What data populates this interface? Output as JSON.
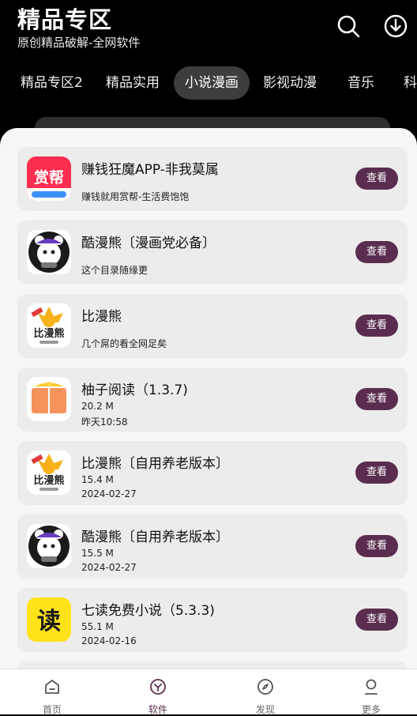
{
  "header": {
    "title": "精品专区",
    "subtitle": "原创精品破解-全网软件"
  },
  "tabs": [
    "精品专区2",
    "精品实用",
    "小说漫画",
    "影视动漫",
    "音乐",
    "科"
  ],
  "active_tab": "小说漫画",
  "apps": [
    {
      "name": "赚钱狂魔APP-非我莫属",
      "desc": "赚钱就用赏帮-生活费饱饱",
      "button": "查看",
      "icon": "shangbang-icon",
      "icon_text": "赏帮"
    },
    {
      "name": "酷漫熊〔漫画党必备〕",
      "desc": "这个目录随缘更",
      "button": "查看",
      "icon": "kumanxiong-icon"
    },
    {
      "name": "比漫熊",
      "desc": "几个屌的看全网足矣",
      "button": "查看",
      "icon": "bimanxiong-icon",
      "icon_text": "比漫熊"
    },
    {
      "name": "柚子阅读（1.3.7)",
      "size": "20.2 M",
      "date": "昨天10:58",
      "button": "查看",
      "icon": "book-icon"
    },
    {
      "name": "比漫熊〔自用养老版本〕",
      "size": "15.4 M",
      "date": "2024-02-27",
      "button": "查看",
      "icon": "bimanxiong-icon",
      "icon_text": "比漫熊"
    },
    {
      "name": "酷漫熊〔自用养老版本〕",
      "size": "15.5 M",
      "date": "2024-02-27",
      "button": "查看",
      "icon": "kumanxiong-icon"
    },
    {
      "name": "七读免费小说（5.3.3)",
      "size": "55.1 M",
      "date": "2024-02-16",
      "button": "查看",
      "icon": "qidu-icon",
      "icon_text": "读"
    }
  ],
  "nav": [
    {
      "label": "首页",
      "icon": "home-icon"
    },
    {
      "label": "软件",
      "icon": "software-icon"
    },
    {
      "label": "发现",
      "icon": "compass-icon"
    },
    {
      "label": "更多",
      "icon": "user-icon"
    }
  ],
  "colors": {
    "accent": "#5a2d4e",
    "header_bg": "#000000",
    "sheet_bg": "#f6f6f6",
    "card_bg": "#ececec"
  }
}
